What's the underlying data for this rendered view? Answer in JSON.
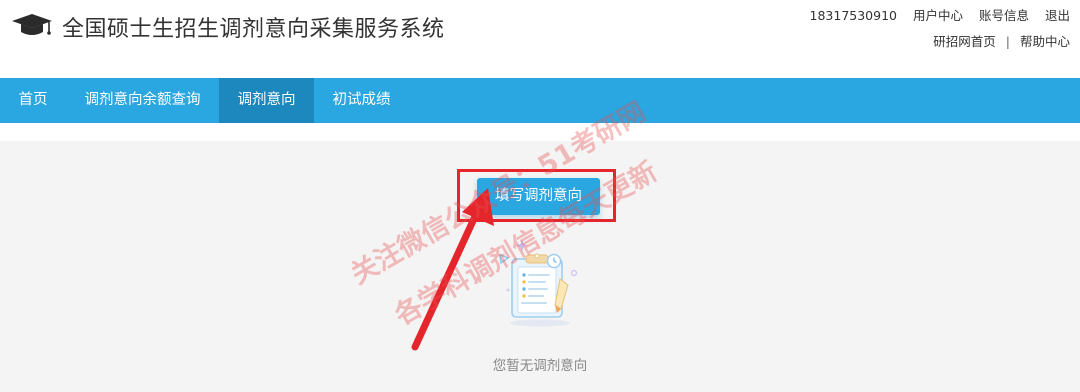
{
  "header": {
    "title": "全国硕士生招生调剂意向采集服务系统",
    "logo_icon": "graduation-cap-icon",
    "phone": "18317530910",
    "user_center": "用户中心",
    "account_info": "账号信息",
    "logout": "退出",
    "portal_home": "研招网首页",
    "separator": "|",
    "help_center": "帮助中心"
  },
  "nav": {
    "items": [
      {
        "label": "首页",
        "active": false
      },
      {
        "label": "调剂意向余额查询",
        "active": false
      },
      {
        "label": "调剂意向",
        "active": true
      },
      {
        "label": "初试成绩",
        "active": false
      }
    ]
  },
  "main": {
    "fill_button_label": "填写调剂意向",
    "empty_text": "您暂无调剂意向",
    "empty_icon": "clipboard-empty-icon"
  },
  "watermark": {
    "line1": "关注微信公众号：51考研网",
    "line2": "各学科调剂信息每天更新"
  },
  "colors": {
    "accent": "#2aa6e0",
    "nav_active": "#1d88bd",
    "highlight": "#e4252b",
    "content_bg": "#f4f4f4"
  }
}
